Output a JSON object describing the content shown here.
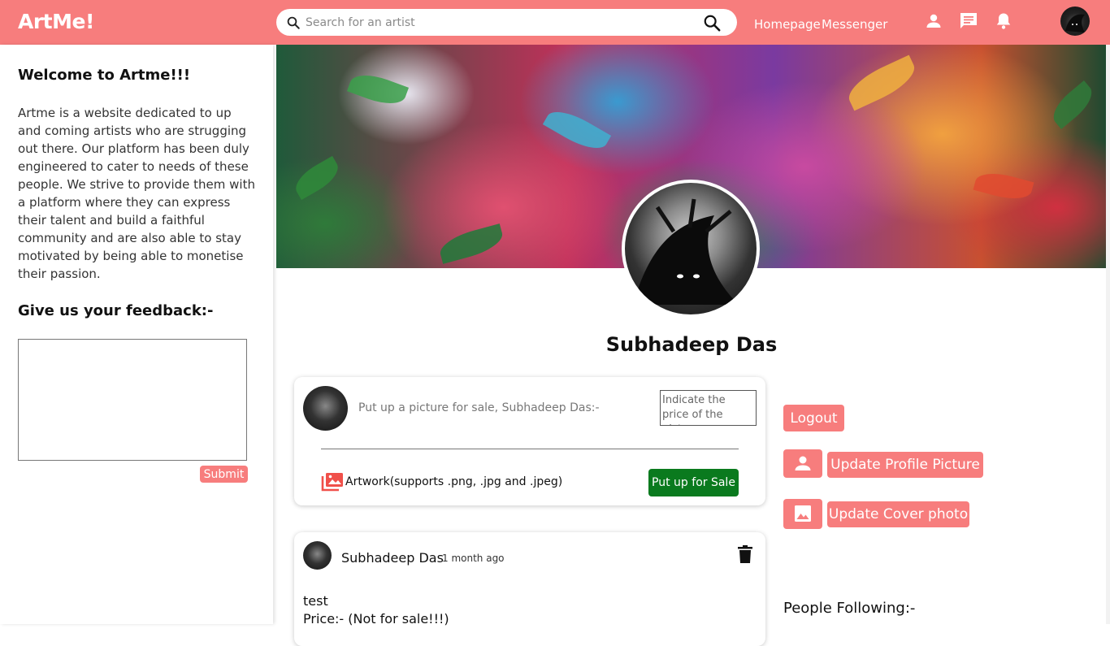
{
  "app": {
    "logo": "ArtMe!"
  },
  "header": {
    "search_placeholder": "Search for an artist",
    "nav": {
      "homepage": "Homepage",
      "messenger": "Messenger"
    },
    "icons": [
      "person-icon",
      "chat-icon",
      "bell-icon"
    ]
  },
  "sidebar": {
    "welcome_title": "Welcome to Artme!!!",
    "about_text": "Artme is a website dedicated to up and coming artists who are strugging out there. Our platform has been duly engineered to cater to needs of these people. We strive to provide them with a platform where they can express their talent and build a faithful community and are also able to stay motivated by being able to monetise their passion.",
    "feedback_title": "Give us your feedback:-",
    "submit_label": "Submit"
  },
  "profile": {
    "name": "Subhadeep Das"
  },
  "post_form": {
    "prompt_placeholder": "Put up a picture for sale, Subhadeep Das:-",
    "price_placeholder": "Indicate the price of the picture:-",
    "artwork_label": "Artwork(supports .png, .jpg and .jpeg)",
    "sale_button": "Put up for Sale"
  },
  "post": {
    "author": "Subhadeep Das",
    "time": "1 month ago",
    "body": "test",
    "price": "Price:- (Not for sale!!!)"
  },
  "actions": {
    "logout": "Logout",
    "update_profile_picture": "Update Profile Picture",
    "update_cover_photo": "Update Cover photo"
  },
  "following": {
    "title": "People Following:-"
  },
  "colors": {
    "brand": "#f77d7d",
    "sale_green": "#0a7a1e"
  }
}
